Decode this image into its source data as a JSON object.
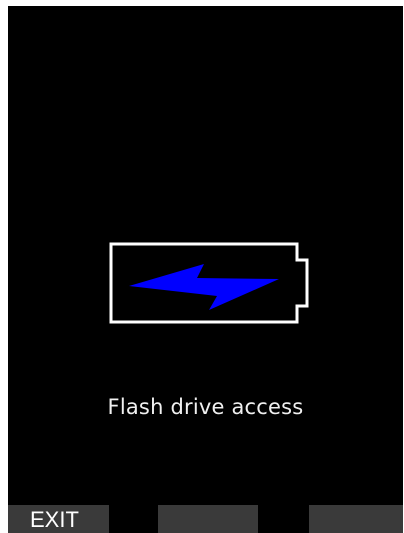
{
  "screen": {
    "icon": "battery-charging-icon",
    "bolt_color": "#0000ff",
    "frame_color": "#ffffff",
    "status_text": "Flash drive access"
  },
  "softkeys": [
    {
      "label": "EXIT"
    },
    {
      "label": ""
    },
    {
      "label": ""
    }
  ]
}
